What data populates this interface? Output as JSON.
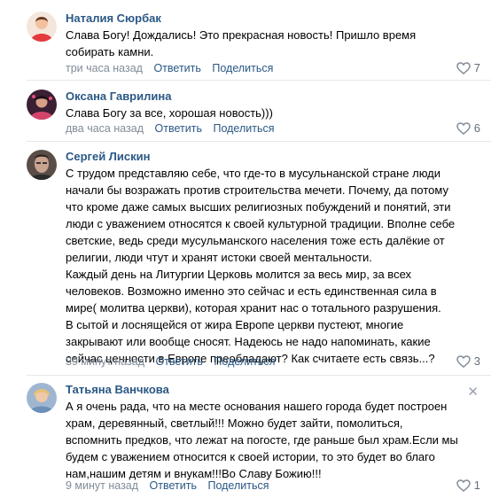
{
  "comments": [
    {
      "author": "Наталия Сюрбак",
      "lines": [
        "Слава Богу! Дождались! Это прекрасная новость! Пришло время",
        "собирать камни."
      ],
      "time": "три часа назад",
      "reply": "Ответить",
      "share": "Поделиться",
      "likes": "7",
      "icon": "heart-icon",
      "avatar_colors": [
        "#e43a3e",
        "#f2c29e"
      ]
    },
    {
      "author": "Оксана Гаврилина",
      "lines": [
        "Слава Богу за все, хорошая новость)))"
      ],
      "time": "два часа назад",
      "reply": "Ответить",
      "share": "Поделиться",
      "likes": "6",
      "icon": "heart-icon",
      "avatar_colors": [
        "#7a2a4e",
        "#d4446a"
      ]
    },
    {
      "author": "Сергей Лискин",
      "lines": [
        "С трудом представляю себе, что где-то в мусульнанской стране люди",
        "начали бы возражать против строительства мечети. Почему, да потому",
        "что кроме даже самых высших религиозных побуждений и понятий, эти",
        "люди с уважением относятся к своей культурной традиции. Вполне себе",
        "светские, ведь среди мусульманского населения тоже есть далёкие от",
        "религии, люди чтут и хранят истоки своей ментальности.",
        "Каждый день на Литургии Церковь молится за весь мир, за всех",
        "человеков. Возможно именно это сейчас и есть единственная сила в",
        "мире( молитва церкви), которая хранит нас о тотального разрушения.",
        "В сытой и лоснящейся от жира Европе церкви пустеют, многие",
        "закрывают или вообще сносят. Надеюсь не надо напоминать, какие",
        "сейчас ценности в Европе преобладают? Как считаете есть связь...?"
      ],
      "time": "39 минут назад",
      "reply": "Ответить",
      "share": "Поделиться",
      "likes": "3",
      "icon": "heart-icon",
      "avatar_colors": [
        "#3a3030",
        "#c9a48f"
      ]
    },
    {
      "author": "Татьяна Ванчкова",
      "lines": [
        "А я очень рада, что на месте основания нашего города будет построен",
        "храм, деревянный, светлый!!! Можно будет зайти, помолиться,",
        "вспомнить предков, что лежат на погосте, где раньше был храм.Если мы",
        "будем с уважением относится к своей истории, то это будет во благо",
        "нам,нашим детям и внукам!!!Во Славу Божию!!!"
      ],
      "time": "9 минут назад",
      "reply": "Ответить",
      "share": "Поделиться",
      "likes": "1",
      "icon": "heart-icon",
      "close": "✕",
      "avatar_colors": [
        "#6b8fb8",
        "#e8c07a"
      ]
    }
  ]
}
